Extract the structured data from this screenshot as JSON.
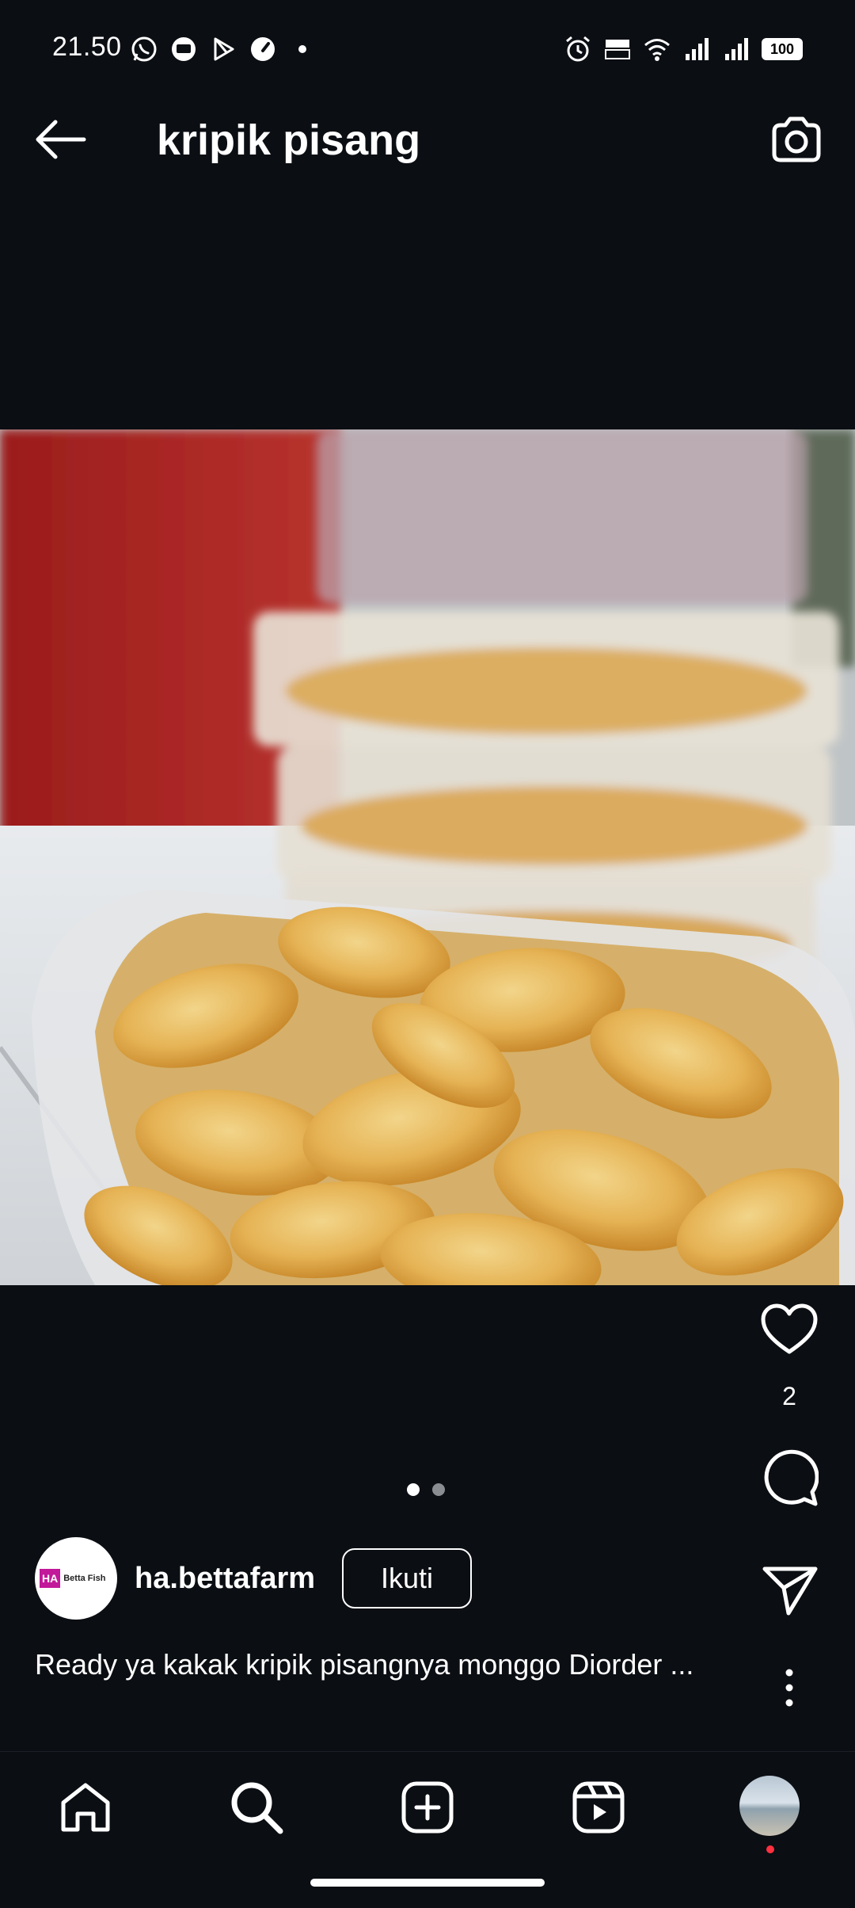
{
  "status_bar": {
    "time": "21.50",
    "battery": "100",
    "left_icons": [
      "whatsapp-icon",
      "chat-bubble-icon",
      "play-store-icon",
      "speed-icon",
      "dot-icon"
    ],
    "right_icons": [
      "alarm-icon",
      "volte-icon",
      "wifi-icon",
      "signal-icon",
      "signal-icon"
    ]
  },
  "header": {
    "title": "kripik pisang",
    "back_icon": "arrow-left-icon",
    "camera_icon": "camera-icon"
  },
  "post": {
    "image_subject": "banana chips in plastic containers",
    "like_count": "2",
    "carousel": {
      "total": 2,
      "active": 1
    },
    "author": {
      "username": "ha.bettafarm",
      "avatar_text_short": "HA",
      "avatar_text_brand": "Betta Fish"
    },
    "follow_label": "Ikuti",
    "caption": "Ready ya kakak kripik pisangnya monggo Diorder ..."
  },
  "bottom_nav": [
    "home-icon",
    "search-icon",
    "create-icon",
    "reels-icon",
    "profile-avatar"
  ],
  "colors": {
    "background": "#0b0e13",
    "text": "#ffffff",
    "notification_dot": "#ff3040",
    "brand_magenta": "#c2189a"
  }
}
